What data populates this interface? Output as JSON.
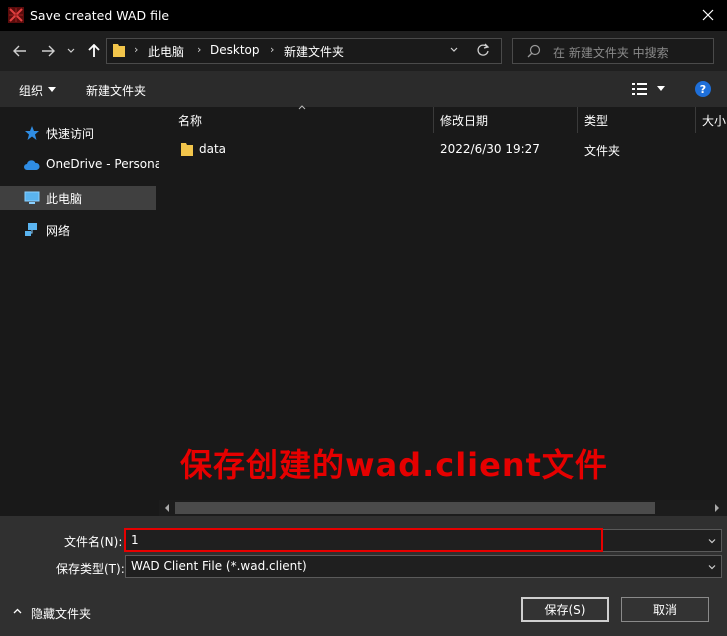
{
  "window": {
    "title": "Save created WAD file"
  },
  "nav": {
    "breadcrumb": [
      "此电脑",
      "Desktop",
      "新建文件夹"
    ],
    "search_placeholder": "在 新建文件夹 中搜索"
  },
  "toolbar": {
    "organize_label": "组织",
    "new_folder_label": "新建文件夹"
  },
  "sidebar": {
    "items": [
      {
        "label": "快速访问",
        "icon": "star-icon"
      },
      {
        "label": "OneDrive - Personal",
        "icon": "cloud-icon"
      },
      {
        "label": "此电脑",
        "icon": "computer-icon",
        "selected": true
      },
      {
        "label": "网络",
        "icon": "network-icon"
      }
    ]
  },
  "file_list": {
    "columns": [
      "名称",
      "修改日期",
      "类型",
      "大小"
    ],
    "rows": [
      {
        "name": "data",
        "modified": "2022/6/30 19:27",
        "type": "文件夹",
        "icon": "folder-icon"
      }
    ]
  },
  "annotation": "保存创建的wad.client文件",
  "form": {
    "filename_label": "文件名(N):",
    "filename_value": "1",
    "filetype_label": "保存类型(T):",
    "filetype_value": "WAD Client File (*.wad.client)"
  },
  "footer": {
    "hide_folders_label": "隐藏文件夹",
    "save_label": "保存(S)",
    "cancel_label": "取消"
  },
  "colors": {
    "annotation_red": "#e60000",
    "help_blue": "#1e6fd9",
    "folder_yellow": "#f2c54b"
  }
}
